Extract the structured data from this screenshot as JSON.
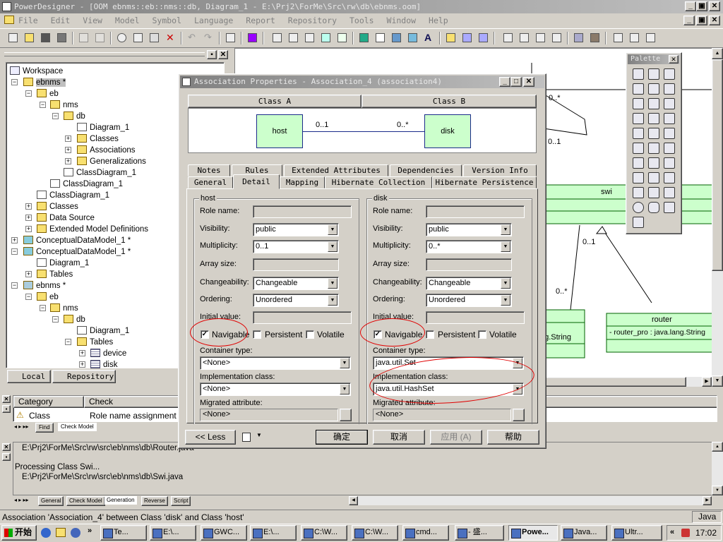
{
  "app": {
    "title": "PowerDesigner - [OOM ebnms::eb::nms::db, Diagram_1 - E:\\Prj2\\ForMe\\Src\\rw\\db\\ebnms.oom]"
  },
  "menu": [
    "File",
    "Edit",
    "View",
    "Model",
    "Symbol",
    "Language",
    "Report",
    "Repository",
    "Tools",
    "Window",
    "Help"
  ],
  "tree": {
    "items": [
      "Workspace",
      "ebnms *",
      "eb",
      "nms",
      "db",
      "Diagram_1",
      "Classes",
      "Associations",
      "Generalizations",
      "ClassDiagram_1",
      "ClassDiagram_1",
      "ClassDiagram_1",
      "Classes",
      "Data Source",
      "Extended Model Definitions",
      "ConceptualDataModel_1 *",
      "ConceptualDataModel_1 *",
      "Diagram_1",
      "Tables",
      "ebnms *",
      "eb",
      "nms",
      "db",
      "Diagram_1",
      "Tables",
      "device",
      "disk"
    ],
    "tabs": [
      "Local",
      "Repository"
    ]
  },
  "dialog": {
    "title": "Association Properties - Association_4 (association4)",
    "class_a_header": "Class A",
    "class_b_header": "Class B",
    "class_a": "host",
    "class_b": "disk",
    "mult_a_preview": "0..1",
    "mult_b_preview": "0..*",
    "tabs_row1": [
      "Notes",
      "Rules",
      "Extended Attributes",
      "Dependencies",
      "Version Info"
    ],
    "tabs_row2": [
      "General",
      "Detail",
      "Mapping",
      "Hibernate Collection",
      "Hibernate Persistence"
    ],
    "active_tab": "Detail",
    "labels": {
      "role_name": "Role name:",
      "visibility": "Visibility:",
      "multiplicity": "Multiplicity:",
      "array_size": "Array size:",
      "changeability": "Changeability:",
      "ordering": "Ordering:",
      "initial_value": "Initial value:",
      "navigable": "Navigable",
      "persistent": "Persistent",
      "volatile": "Volatile",
      "container_type": "Container type:",
      "implementation_class": "Implementation class:",
      "migrated_attribute": "Migrated attribute:"
    },
    "left": {
      "group": "host",
      "visibility": "public",
      "multiplicity": "0..1",
      "changeability": "Changeable",
      "ordering": "Unordered",
      "navigable": true,
      "persistent": false,
      "volatile": false,
      "container_type": "<None>",
      "implementation_class": "<None>",
      "migrated_attribute": "<None>"
    },
    "right": {
      "group": "disk",
      "visibility": "public",
      "multiplicity": "0..*",
      "changeability": "Changeable",
      "ordering": "Unordered",
      "navigable": true,
      "persistent": false,
      "volatile": false,
      "container_type": "java.util.Set",
      "implementation_class": "java.util.HashSet",
      "migrated_attribute": "<None>"
    },
    "buttons": {
      "less": "<< Less",
      "ok": "确定",
      "cancel": "取消",
      "apply": "应用 (A)",
      "help": "帮助"
    }
  },
  "palette": {
    "title": "Palette"
  },
  "diagram": {
    "swi_label": "swi",
    "router_label": "router",
    "router_attr": "-  router_pro   : java.lang.String",
    "string_attr": "ng.String",
    "mult_top": "0..*",
    "mult_1": "0..1",
    "mult_2": "0..1",
    "mult_3": "0..*"
  },
  "check_panel": {
    "headers": [
      "Category",
      "Check"
    ],
    "row": {
      "category": "Class",
      "check": "Role name assignment"
    },
    "tabs": [
      "Find",
      "Check Model"
    ]
  },
  "output": {
    "lines": [
      "E:\\Prj2\\ForMe\\Src\\rw\\src\\eb\\nms\\db\\Router.java",
      "",
      "Processing Class Swi...",
      "E:\\Prj2\\ForMe\\Src\\rw\\src\\eb\\nms\\db\\Swi.java"
    ],
    "tabs": [
      "General",
      "Check Model",
      "Generation",
      "Reverse",
      "Script"
    ]
  },
  "status": {
    "text": "Association 'Association_4' between Class 'disk' and Class 'host'",
    "lang": "Java"
  },
  "taskbar": {
    "start": "开始",
    "items": [
      "Te...",
      "E:\\...",
      "GWC...",
      "E:\\...",
      "C:\\W...",
      "C:\\W...",
      "cmd...",
      "- 盛...",
      "Powe...",
      "Java...",
      "Ultr..."
    ],
    "clock": "17:02"
  }
}
